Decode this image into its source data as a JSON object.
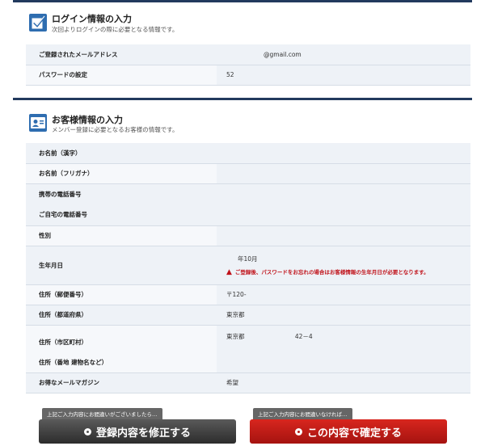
{
  "login_section": {
    "title": "ログイン情報の入力",
    "subtitle": "次回よりログインの際に必要となる情報です。",
    "icon": "checkbox-icon",
    "rows": [
      {
        "label": "ご登録されたメールアドレス",
        "value": "@gmail.com"
      },
      {
        "label": "パスワードの設定",
        "value": "52"
      }
    ]
  },
  "customer_section": {
    "title": "お客様情報の入力",
    "subtitle": "メンバー登録に必要となるお客様の情報です。",
    "icon": "id-card-icon",
    "rows": [
      {
        "label": "お名前（漢字）",
        "value": ""
      },
      {
        "label": "お名前（フリガナ）",
        "value": ""
      },
      {
        "label": "携帯の電話番号",
        "value": ""
      },
      {
        "label": "ご自宅の電話番号",
        "value": ""
      },
      {
        "label": "性別",
        "value": ""
      },
      {
        "label": "生年月日",
        "value": "年10月"
      },
      {
        "label": "住所（郵便番号）",
        "value": "〒120-"
      },
      {
        "label": "住所（都道府県）",
        "value": "東京都"
      },
      {
        "label": "住所（市区町村）",
        "value": "東京都",
        "value2": "42－4"
      },
      {
        "label": "住所（番地 建物名など）",
        "value": ""
      },
      {
        "label": "お得なメールマガジン",
        "value": "希望"
      }
    ],
    "birthdate_warning": "ご登録後、パスワードをお忘れの場合はお客様情報の生年月日が必要となります。"
  },
  "actions": {
    "edit_note": "上記ご入力内容にお間違いがございましたら…",
    "edit_label": "登録内容を修正する",
    "confirm_note": "上記ご入力内容にお間違いなければ…",
    "confirm_label": "この内容で確定する"
  },
  "colors": {
    "navy": "#223a5e",
    "accent_blue": "#2e6db0",
    "warning_red": "#c0121a",
    "confirm_red": "#c8201a"
  }
}
